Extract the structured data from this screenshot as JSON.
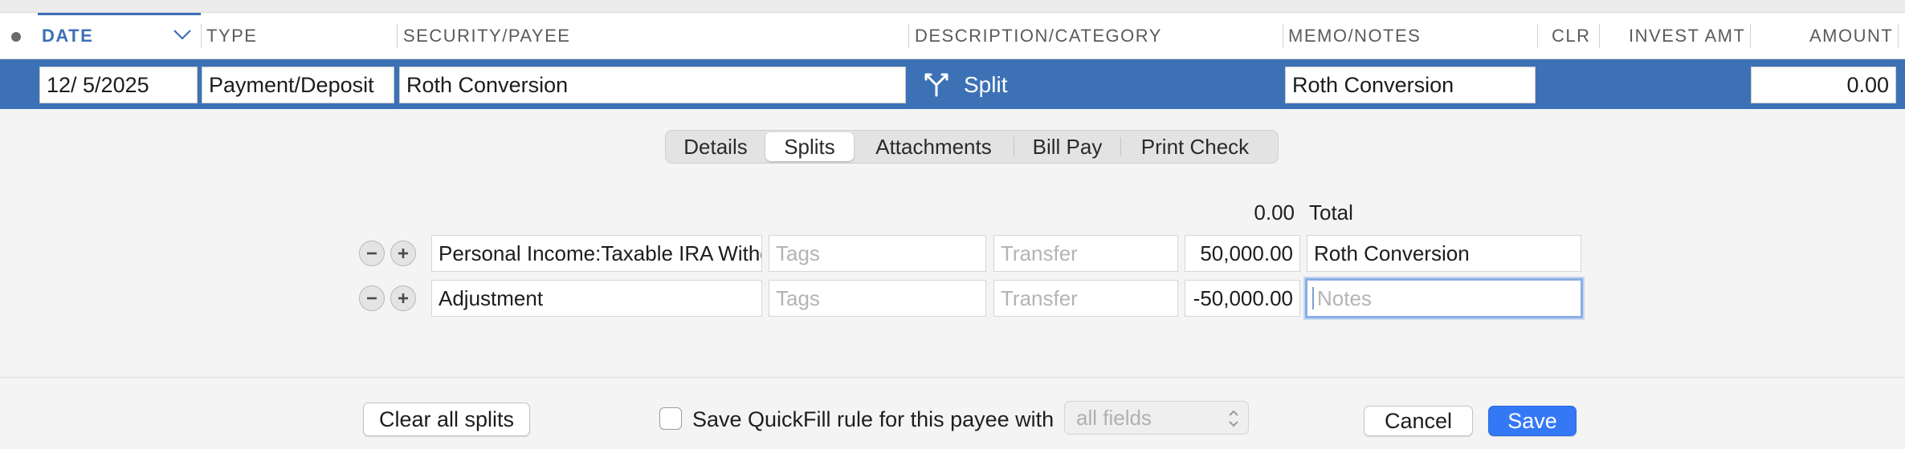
{
  "columns": {
    "date": "DATE",
    "type": "TYPE",
    "security_payee": "SECURITY/PAYEE",
    "description_category": "DESCRIPTION/CATEGORY",
    "memo_notes": "MEMO/NOTES",
    "clr": "CLR",
    "invest_amt": "INVEST AMT",
    "amount": "AMOUNT"
  },
  "transaction": {
    "date": "12/  5/2025",
    "type": "Payment/Deposit",
    "payee": "Roth Conversion",
    "category": "Split",
    "memo": "Roth Conversion",
    "amount": "0.00"
  },
  "tabs": [
    "Details",
    "Splits",
    "Attachments",
    "Bill Pay",
    "Print Check"
  ],
  "active_tab": "Splits",
  "splits": {
    "total_amount": "0.00",
    "total_label": "Total",
    "rows": [
      {
        "category": "Personal Income:Taxable IRA Withdrawal",
        "tags_placeholder": "Tags",
        "transfer_placeholder": "Transfer",
        "amount": "50,000.00",
        "notes": "Roth Conversion",
        "notes_placeholder": "Notes"
      },
      {
        "category": "Adjustment",
        "tags_placeholder": "Tags",
        "transfer_placeholder": "Transfer",
        "amount": "-50,000.00",
        "notes": "",
        "notes_placeholder": "Notes"
      }
    ]
  },
  "footer": {
    "clear_splits": "Clear all splits",
    "quickfill_label": "Save QuickFill rule for this payee with",
    "quickfill_checked": false,
    "fields_select": "all fields",
    "cancel": "Cancel",
    "save": "Save"
  },
  "colors": {
    "selection": "#3d71b5",
    "accent": "#3d6fb8",
    "primary_button": "#3478f6"
  }
}
